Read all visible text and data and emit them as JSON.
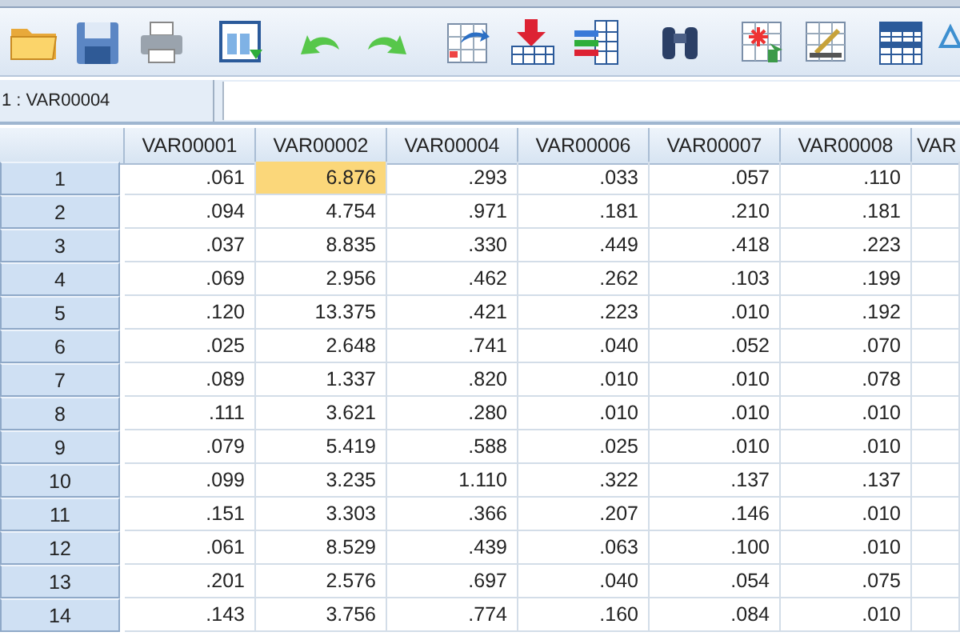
{
  "cell_editor": {
    "reference": "1 : VAR00004"
  },
  "table": {
    "columns": [
      "VAR00001",
      "VAR00002",
      "VAR00004",
      "VAR00006",
      "VAR00007",
      "VAR00008",
      "VAR"
    ],
    "rows": [
      {
        "label": "1",
        "cells": [
          {
            "value": ".061",
            "selected": false
          },
          {
            "value": "6.876",
            "selected": true
          },
          {
            "value": ".293",
            "selected": false
          },
          {
            "value": ".033",
            "selected": false
          },
          {
            "value": ".057",
            "selected": false
          },
          {
            "value": ".110",
            "selected": false
          }
        ]
      },
      {
        "label": "2",
        "cells": [
          {
            "value": ".094",
            "selected": false
          },
          {
            "value": "4.754",
            "selected": false
          },
          {
            "value": ".971",
            "selected": false
          },
          {
            "value": ".181",
            "selected": false
          },
          {
            "value": ".210",
            "selected": false
          },
          {
            "value": ".181",
            "selected": false
          }
        ]
      },
      {
        "label": "3",
        "cells": [
          {
            "value": ".037",
            "selected": false
          },
          {
            "value": "8.835",
            "selected": false
          },
          {
            "value": ".330",
            "selected": false
          },
          {
            "value": ".449",
            "selected": false
          },
          {
            "value": ".418",
            "selected": false
          },
          {
            "value": ".223",
            "selected": false
          }
        ]
      },
      {
        "label": "4",
        "cells": [
          {
            "value": ".069",
            "selected": false
          },
          {
            "value": "2.956",
            "selected": false
          },
          {
            "value": ".462",
            "selected": false
          },
          {
            "value": ".262",
            "selected": false
          },
          {
            "value": ".103",
            "selected": false
          },
          {
            "value": ".199",
            "selected": false
          }
        ]
      },
      {
        "label": "5",
        "cells": [
          {
            "value": ".120",
            "selected": false
          },
          {
            "value": "13.375",
            "selected": false
          },
          {
            "value": ".421",
            "selected": false
          },
          {
            "value": ".223",
            "selected": false
          },
          {
            "value": ".010",
            "selected": false
          },
          {
            "value": ".192",
            "selected": false
          }
        ]
      },
      {
        "label": "6",
        "cells": [
          {
            "value": ".025",
            "selected": false
          },
          {
            "value": "2.648",
            "selected": false
          },
          {
            "value": ".741",
            "selected": false
          },
          {
            "value": ".040",
            "selected": false
          },
          {
            "value": ".052",
            "selected": false
          },
          {
            "value": ".070",
            "selected": false
          }
        ]
      },
      {
        "label": "7",
        "cells": [
          {
            "value": ".089",
            "selected": false
          },
          {
            "value": "1.337",
            "selected": false
          },
          {
            "value": ".820",
            "selected": false
          },
          {
            "value": ".010",
            "selected": false
          },
          {
            "value": ".010",
            "selected": false
          },
          {
            "value": ".078",
            "selected": false
          }
        ]
      },
      {
        "label": "8",
        "cells": [
          {
            "value": ".111",
            "selected": false
          },
          {
            "value": "3.621",
            "selected": false
          },
          {
            "value": ".280",
            "selected": false
          },
          {
            "value": ".010",
            "selected": false
          },
          {
            "value": ".010",
            "selected": false
          },
          {
            "value": ".010",
            "selected": false
          }
        ]
      },
      {
        "label": "9",
        "cells": [
          {
            "value": ".079",
            "selected": false
          },
          {
            "value": "5.419",
            "selected": false
          },
          {
            "value": ".588",
            "selected": false
          },
          {
            "value": ".025",
            "selected": false
          },
          {
            "value": ".010",
            "selected": false
          },
          {
            "value": ".010",
            "selected": false
          }
        ]
      },
      {
        "label": "10",
        "cells": [
          {
            "value": ".099",
            "selected": false
          },
          {
            "value": "3.235",
            "selected": false
          },
          {
            "value": "1.110",
            "selected": false
          },
          {
            "value": ".322",
            "selected": false
          },
          {
            "value": ".137",
            "selected": false
          },
          {
            "value": ".137",
            "selected": false
          }
        ]
      },
      {
        "label": "11",
        "cells": [
          {
            "value": ".151",
            "selected": false
          },
          {
            "value": "3.303",
            "selected": false
          },
          {
            "value": ".366",
            "selected": false
          },
          {
            "value": ".207",
            "selected": false
          },
          {
            "value": ".146",
            "selected": false
          },
          {
            "value": ".010",
            "selected": false
          }
        ]
      },
      {
        "label": "12",
        "cells": [
          {
            "value": ".061",
            "selected": false
          },
          {
            "value": "8.529",
            "selected": false
          },
          {
            "value": ".439",
            "selected": false
          },
          {
            "value": ".063",
            "selected": false
          },
          {
            "value": ".100",
            "selected": false
          },
          {
            "value": ".010",
            "selected": false
          }
        ]
      },
      {
        "label": "13",
        "cells": [
          {
            "value": ".201",
            "selected": false
          },
          {
            "value": "2.576",
            "selected": false
          },
          {
            "value": ".697",
            "selected": false
          },
          {
            "value": ".040",
            "selected": false
          },
          {
            "value": ".054",
            "selected": false
          },
          {
            "value": ".075",
            "selected": false
          }
        ]
      },
      {
        "label": "14",
        "cells": [
          {
            "value": ".143",
            "selected": false
          },
          {
            "value": "3.756",
            "selected": false
          },
          {
            "value": ".774",
            "selected": false
          },
          {
            "value": ".160",
            "selected": false
          },
          {
            "value": ".084",
            "selected": false
          },
          {
            "value": ".010",
            "selected": false
          }
        ]
      }
    ]
  }
}
